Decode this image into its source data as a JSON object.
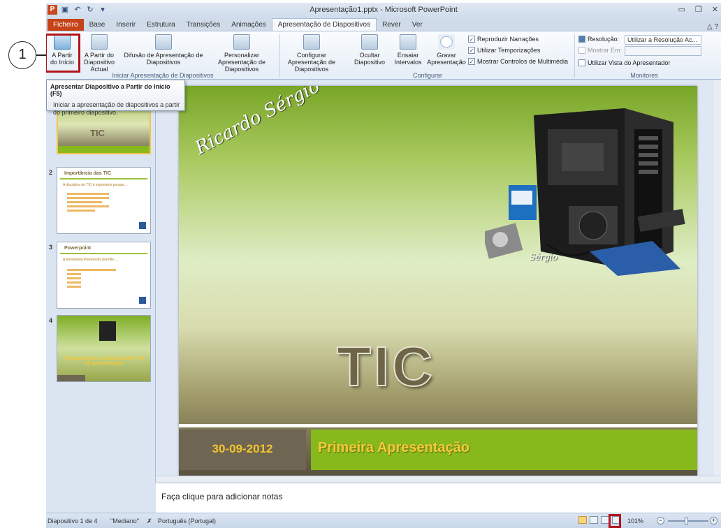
{
  "callout_number": "1",
  "window": {
    "title": "Apresentação1.pptx - Microsoft PowerPoint",
    "logo": "P"
  },
  "tabs": [
    "Ficheiro",
    "Base",
    "Inserir",
    "Estrutura",
    "Transições",
    "Animações",
    "Apresentação de Diapositivos",
    "Rever",
    "Ver"
  ],
  "ribbon": {
    "start_group": {
      "label": "Iniciar Apresentação de Diapositivos",
      "from_beginning": "A Partir do Início",
      "from_current": "A Partir do Diapositivo Actual",
      "broadcast": "Difusão de Apresentação de Diapositivos",
      "custom": "Personalizar Apresentação de Diapositivos"
    },
    "config_group": {
      "label": "Configurar",
      "setup": "Configurar Apresentação de Diapositivos",
      "hide": "Ocultar Diapositivo",
      "rehearse": "Ensaiar Intervalos",
      "record": "Gravar Apresentação",
      "play_narrations": "Reproduzir Narrações",
      "use_timings": "Utilizar Temporizações",
      "show_media_controls": "Mostrar Controlos de Multimédia"
    },
    "monitors_group": {
      "label": "Monitores",
      "resolution_label": "Resolução:",
      "resolution_value": "Utilizar a Resolução Ac...",
      "show_on_label": "Mostrar Em:",
      "presenter_view": "Utilizar Vista do Apresentador"
    }
  },
  "tooltip": {
    "title": "Apresentar Diapositivo a Partir do Início (F5)",
    "body": "Iniciar a apresentação de diapositivos a partir do primeiro diapositivo."
  },
  "thumbnails": [
    {
      "num": "1",
      "title": "TIC"
    },
    {
      "num": "2",
      "title": "Importância das TIC",
      "bullets": [
        "A disciplina de TIC é importante porque..."
      ]
    },
    {
      "num": "3",
      "title": "Powerpoint",
      "bullets": [
        "A ferramenta Powerpoint permite..."
      ]
    },
    {
      "num": "4",
      "title": "Obrigado pela vossa atenção! Fim da apresentação."
    }
  ],
  "slide": {
    "signature": "Ricardo Sérgio",
    "signature_small": "Sérgio",
    "big_title": "TIC",
    "date": "30-09-2012",
    "subtitle": "Primeira Apresentação"
  },
  "notes_placeholder": "Faça clique para adicionar notas",
  "status": {
    "slide_info": "Diapositivo 1 de 4",
    "theme": "\"Mediano\"",
    "language": "Português (Portugal)",
    "zoom": "101%"
  }
}
